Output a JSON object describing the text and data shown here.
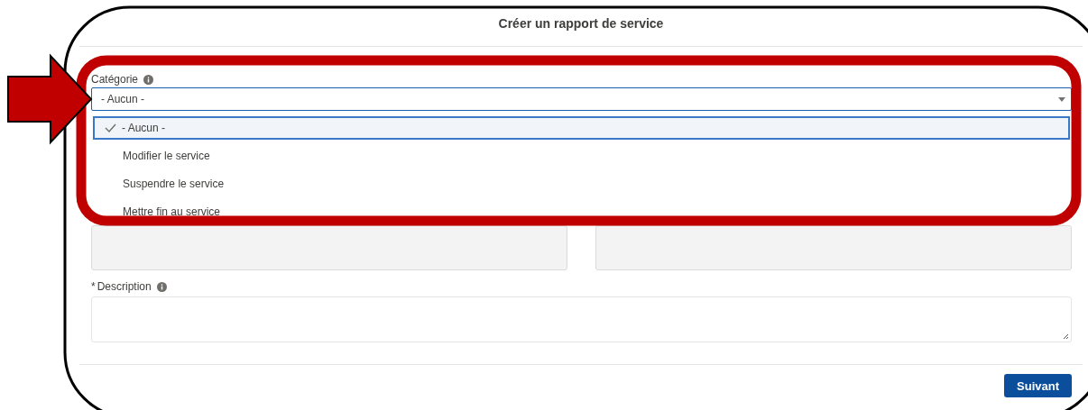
{
  "dialog": {
    "title": "Créer un rapport de service"
  },
  "category": {
    "label": "Catégorie",
    "value": "- Aucun -",
    "expanded": true,
    "options": [
      {
        "label": "- Aucun -",
        "selected": true
      },
      {
        "label": "Modifier le service",
        "selected": false
      },
      {
        "label": "Suspendre le service",
        "selected": false
      },
      {
        "label": "Mettre fin au service",
        "selected": false
      }
    ]
  },
  "description": {
    "label": "Description",
    "required_mark": "*"
  },
  "buttons": [
    {
      "label": "Suivant"
    }
  ]
}
